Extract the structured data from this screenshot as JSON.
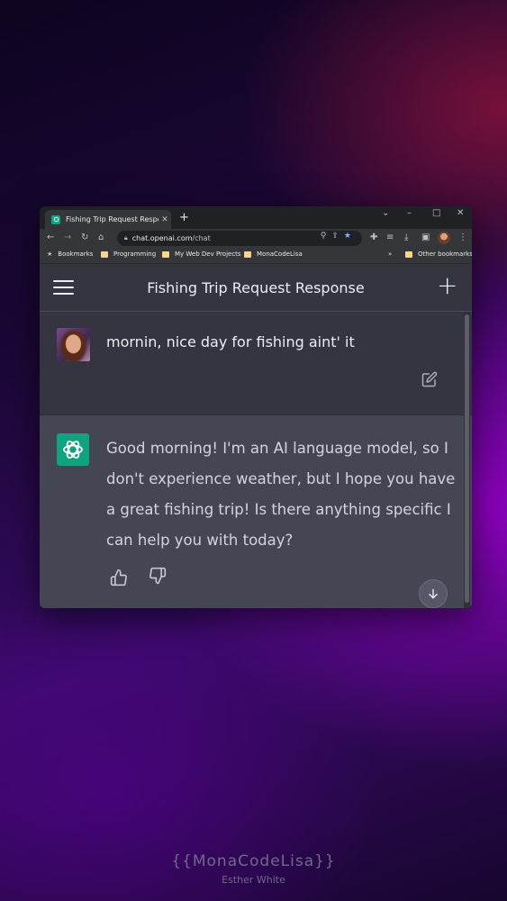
{
  "browser": {
    "tab_title": "Fishing Trip Request Response",
    "tab_close": "✕",
    "new_tab": "+",
    "url_host": "chat.openai.com",
    "url_path": "/chat",
    "window_controls": {
      "minimize": "–",
      "maximize": "□",
      "close": "✕",
      "dropdown": "⌄"
    },
    "bookmarks": [
      {
        "label": "Bookmarks",
        "icon": "star-icon"
      },
      {
        "label": "Programming",
        "icon": "folder-icon"
      },
      {
        "label": "My Web Dev Projects",
        "icon": "folder-icon"
      },
      {
        "label": "MonaCodeLisa",
        "icon": "folder-icon"
      }
    ],
    "overflow": "»",
    "other_bookmarks": "Other bookmarks"
  },
  "chat": {
    "title": "Fishing Trip Request Response",
    "new_chat": "+",
    "user_message": "mornin, nice day for fishing aint' it",
    "assistant_message": "Good morning! I'm an AI language model, so I don't experience weather, but I hope you have a great fishing trip! Is there anything specific I can help you with today?"
  },
  "watermark": {
    "brand": "{{MonaCodeLisa}}",
    "author": "Esther White"
  },
  "colors": {
    "accent": "#10a37f",
    "chat_bg": "#343541",
    "assistant_bg": "#444654",
    "browser_dark": "#202124"
  }
}
